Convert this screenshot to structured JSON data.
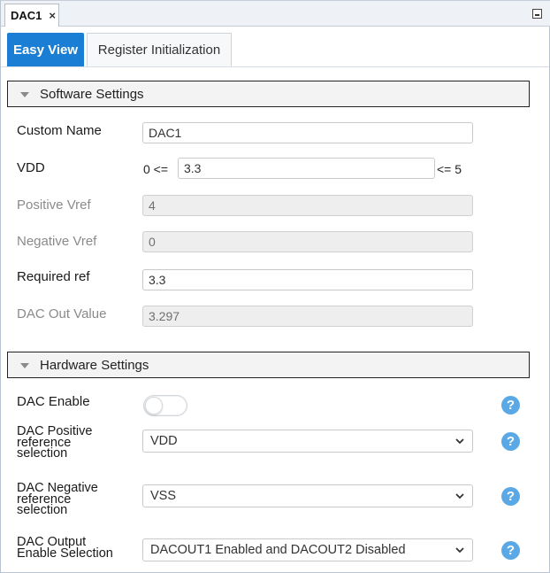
{
  "doc_tab": {
    "title": "DAC1",
    "close": "×"
  },
  "view_tabs": {
    "easy_view": "Easy View",
    "register_init": "Register Initialization"
  },
  "software": {
    "header": "Software Settings",
    "custom_name": {
      "label": "Custom Name",
      "value": "DAC1"
    },
    "vdd": {
      "label": "VDD",
      "prefix": "0 <=",
      "value": "3.3",
      "suffix": "<= 5"
    },
    "positive_vref": {
      "label": "Positive Vref",
      "value": "4"
    },
    "negative_vref": {
      "label": "Negative Vref",
      "value": "0"
    },
    "required_ref": {
      "label": "Required ref",
      "value": "3.3"
    },
    "dac_out_value": {
      "label": "DAC Out Value",
      "value": "3.297"
    }
  },
  "hardware": {
    "header": "Hardware Settings",
    "dac_enable": {
      "label": "DAC Enable",
      "enabled": false
    },
    "positive_ref": {
      "label_lines": [
        "DAC Positive",
        "reference",
        "selection"
      ],
      "value": "VDD"
    },
    "negative_ref": {
      "label_lines": [
        "DAC Negative",
        "reference",
        "selection"
      ],
      "value": "VSS"
    },
    "output_enable": {
      "label_lines": [
        "DAC Output",
        "Enable Selection"
      ],
      "value": "DACOUT1 Enabled and DACOUT2 Disabled"
    },
    "help_glyph": "?"
  },
  "colors": {
    "accent": "#1a7fd4",
    "help": "#5aa9e6"
  }
}
